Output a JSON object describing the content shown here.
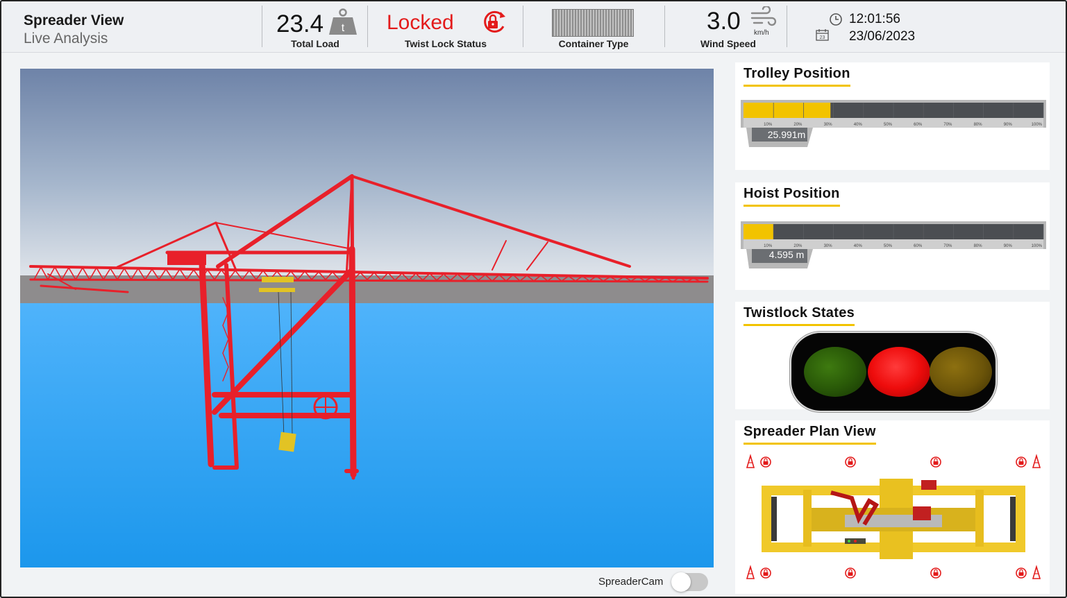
{
  "header": {
    "title": "Spreader View",
    "subtitle": "Live Analysis",
    "total_load": {
      "value": "23.4",
      "unit": "t",
      "label": "Total Load",
      "icon": "weight-icon"
    },
    "twist_lock": {
      "value": "Locked",
      "label": "Twist Lock Status",
      "icon": "lock-rotate-icon",
      "color": "#e31b1b"
    },
    "container": {
      "label": "Container Type"
    },
    "wind": {
      "value": "3.0",
      "unit": "km/h",
      "label": "Wind Speed",
      "icon": "wind-icon"
    },
    "time": "12:01:56",
    "date": "23/06/2023",
    "calendar_day": "23"
  },
  "viewport": {
    "toggle_label": "SpreaderCam",
    "toggle_on": false
  },
  "trolley": {
    "title": "Trolley Position",
    "value_text": "25.991m",
    "fill_fraction": 0.29,
    "ticks": [
      "10%",
      "20%",
      "30%",
      "40%",
      "50%",
      "60%",
      "70%",
      "80%",
      "90%",
      "100%"
    ]
  },
  "hoist": {
    "title": "Hoist Position",
    "value_text": "4.595 m",
    "fill_fraction": 0.1,
    "ticks": [
      "10%",
      "20%",
      "30%",
      "40%",
      "50%",
      "60%",
      "70%",
      "80%",
      "90%",
      "100%"
    ]
  },
  "twistlock": {
    "title": "Twistlock States",
    "active": "red"
  },
  "spreader": {
    "title": "Spreader Plan View"
  },
  "colors": {
    "accent": "#f2c300",
    "alert": "#e31b1b",
    "crane": "#e8202a",
    "water": "#2aa3f5"
  }
}
